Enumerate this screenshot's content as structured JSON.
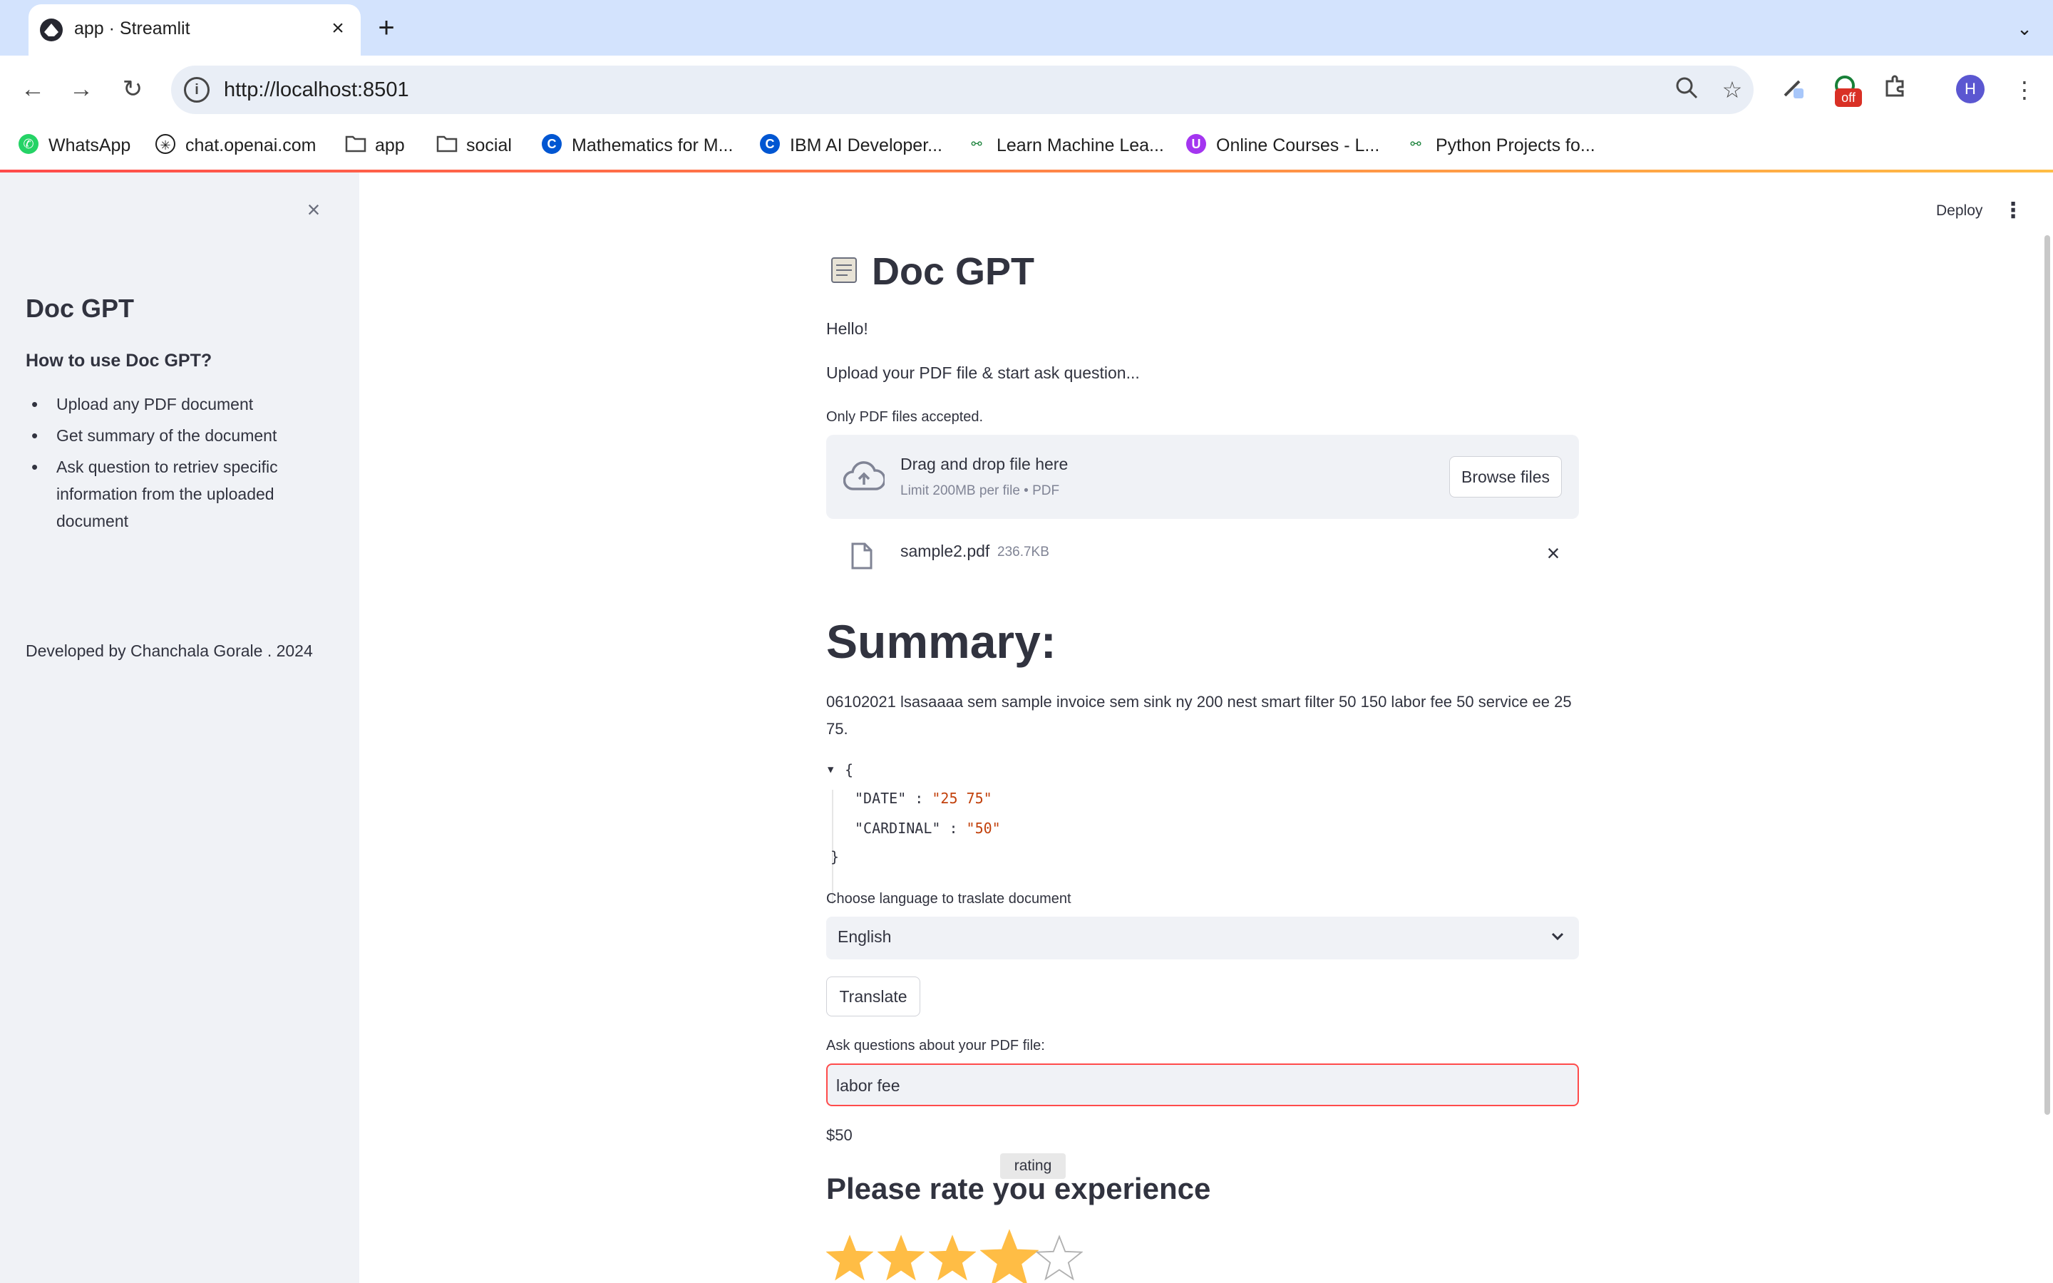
{
  "browser": {
    "tab_title": "app · Streamlit",
    "url": "http://localhost:8501",
    "extension_badge": "off",
    "profile_initial": "H",
    "bookmarks": [
      {
        "label": "WhatsApp",
        "icon": "whatsapp-icon"
      },
      {
        "label": "chat.openai.com",
        "icon": "openai-icon"
      },
      {
        "label": "app",
        "icon": "folder-icon"
      },
      {
        "label": "social",
        "icon": "folder-icon"
      },
      {
        "label": "Mathematics for M...",
        "icon": "coursera-icon"
      },
      {
        "label": "IBM AI Developer...",
        "icon": "coursera-icon"
      },
      {
        "label": "Learn Machine Lea...",
        "icon": "link-icon"
      },
      {
        "label": "Online Courses - L...",
        "icon": "udemy-icon"
      },
      {
        "label": "Python Projects fo...",
        "icon": "link-icon"
      }
    ]
  },
  "sidebar": {
    "title": "Doc GPT",
    "subtitle": "How to use Doc GPT?",
    "items": [
      "Upload any PDF document",
      "Get summary of the document",
      "Ask question to retriev specific information from the uploaded document"
    ],
    "credit": "Developed by Chanchala Gorale . 2024"
  },
  "header": {
    "deploy_label": "Deploy"
  },
  "main": {
    "title": "Doc GPT",
    "greeting": "Hello!",
    "instruction": "Upload your PDF file & start ask question...",
    "uploader": {
      "label": "Only PDF files accepted.",
      "drop_text": "Drag and drop file here",
      "limit_text": "Limit 200MB per file • PDF",
      "browse_label": "Browse files"
    },
    "file": {
      "name": "sample2.pdf",
      "size": "236.7KB"
    },
    "summary_heading": "Summary:",
    "summary_text": "06102021 lsasaaaa sem sample invoice sem sink ny 200 nest smart filter 50 150 labor fee 50 service ee 25 75.",
    "json": {
      "open": "{",
      "close": "}",
      "entries": [
        {
          "key": "\"DATE\"",
          "value": "\"25 75\""
        },
        {
          "key": "\"CARDINAL\"",
          "value": "\"50\""
        }
      ]
    },
    "language": {
      "label": "Choose language to traslate document",
      "selected": "English"
    },
    "translate_label": "Translate",
    "question": {
      "label": "Ask questions about your PDF file:",
      "value": "labor fee"
    },
    "answer": "$50",
    "rating": {
      "tooltip": "rating",
      "heading": "Please rate you experience",
      "value": 4,
      "max": 5
    }
  },
  "colors": {
    "accent": "#ff4b4b",
    "star_filled": "#ffbd45",
    "sidebar_bg": "#f0f2f6",
    "chrome_tabbar": "#d3e3fd"
  }
}
